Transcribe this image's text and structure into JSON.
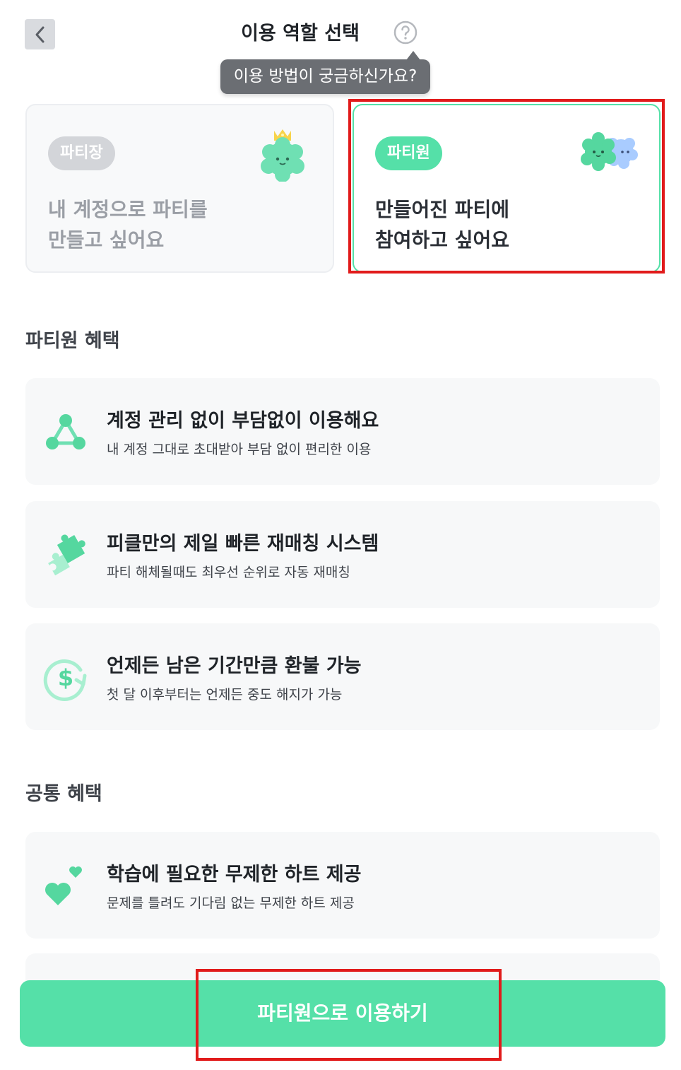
{
  "header": {
    "back_icon": "chevron-left-icon",
    "title": "이용 역할 선택",
    "help_icon": "question-circle-icon",
    "tooltip": "이용 방법이 궁금하신가요?"
  },
  "roles": [
    {
      "badge": "파티장",
      "line1": "내 계정으로 파티를",
      "line2": "만들고 싶어요",
      "selected": false,
      "mascot": "crowned-mascot-icon"
    },
    {
      "badge": "파티원",
      "line1": "만들어진 파티에",
      "line2": "참여하고 싶어요",
      "selected": true,
      "mascot": "two-mascots-icon"
    }
  ],
  "partymember_section": {
    "title": "파티원 혜택",
    "items": [
      {
        "icon": "network-nodes-icon",
        "title": "계정 관리 없이 부담없이 이용해요",
        "desc": "내 계정 그대로 초대받아 부담 없이 편리한 이용"
      },
      {
        "icon": "puzzle-pieces-icon",
        "title": "피클만의 제일 빠른 재매칭 시스템",
        "desc": "파티 해체될때도 최우선 순위로 자동 재매칭"
      },
      {
        "icon": "dollar-refund-icon",
        "title": "언제든 남은 기간만큼 환불 가능",
        "desc": "첫 달 이후부터는 언제든 중도 해지가 가능"
      }
    ]
  },
  "common_section": {
    "title": "공통 혜택",
    "items": [
      {
        "icon": "hearts-icon",
        "title": "학습에 필요한 무제한 하트 제공",
        "desc": "문제를 틀려도 기다림 없는 무제한 하트 제공"
      }
    ]
  },
  "cta": {
    "label": "파티원으로 이용하기"
  },
  "colors": {
    "accent": "#55e0a8",
    "highlight": "#e11b1b",
    "card_bg": "#f7f8f9"
  }
}
